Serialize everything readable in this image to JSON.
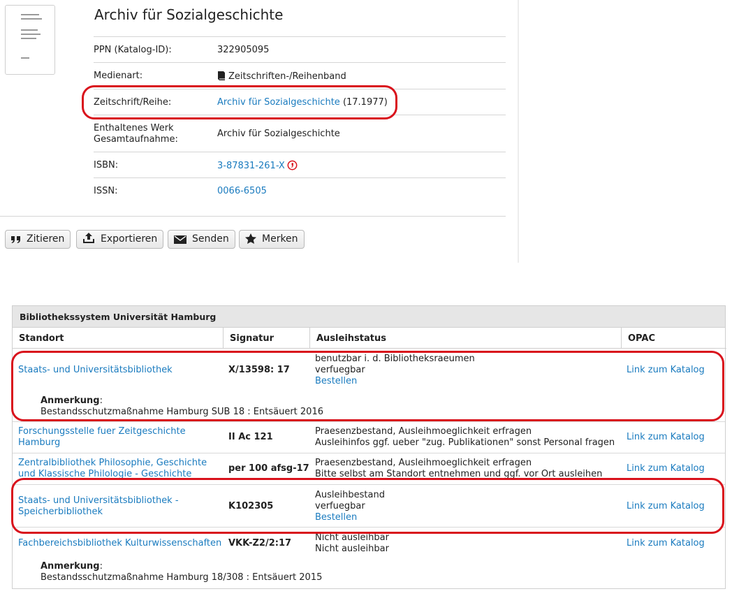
{
  "record": {
    "title": "Archiv für Sozialgeschichte",
    "fields": [
      {
        "label": "PPN (Katalog-ID):",
        "value": "322905095"
      },
      {
        "label": "Medienart:",
        "value": "Zeitschriften-/Reihenband"
      },
      {
        "label": "Zeitschrift/Reihe:",
        "link": "Archiv für Sozialgeschichte",
        "extra": "(17.1977)"
      },
      {
        "label1": "Enthaltenes Werk",
        "label2": "Gesamtaufnahme:",
        "value": "Archiv für Sozialgeschichte"
      },
      {
        "label": "ISBN:",
        "link": "3-87831-261-X"
      },
      {
        "label": "ISSN:",
        "link": "0066-6505"
      }
    ]
  },
  "actions": {
    "cite": "Zitieren",
    "export": "Exportieren",
    "send": "Senden",
    "bookmark": "Merken"
  },
  "holdings": {
    "title": "Bibliothekssystem Universität Hamburg",
    "columns": [
      "Standort",
      "Signatur",
      "Ausleihstatus",
      "OPAC"
    ],
    "note_label": "Anmerkung",
    "note_colon": ":",
    "rows": [
      {
        "location": "Staats- und Universitätsbibliothek",
        "signature": "X/13598: 17",
        "status1": "benutzbar i. d. Bibliotheksraeumen",
        "status2": "verfuegbar",
        "order": "Bestellen",
        "opac": "Link zum Katalog",
        "note": "Bestandsschutzmaßnahme Hamburg SUB 18 : Entsäuert 2016"
      },
      {
        "location1": "Forschungsstelle fuer Zeitgeschichte",
        "location2": "Hamburg",
        "signature": "II Ac 121",
        "status1": "Praesenzbestand, Ausleihmoeglichkeit erfragen",
        "status2": "Ausleihinfos ggf. ueber \"zug. Publikationen\" sonst Personal fragen",
        "opac": "Link zum Katalog"
      },
      {
        "location1": "Zentralbibliothek Philosophie, Geschichte",
        "location2": "und Klassische Philologie - Geschichte",
        "signature": "per 100 afsg-17",
        "status1": "Praesenzbestand, Ausleihmoeglichkeit erfragen",
        "status2": "Bitte selbst am Standort entnehmen und ggf. vor Ort ausleihen",
        "opac": "Link zum Katalog"
      },
      {
        "location1": "Staats- und Universitätsbibliothek -",
        "location2": "Speicherbibliothek",
        "signature": "K102305",
        "status1": "Ausleihbestand",
        "status2": "verfuegbar",
        "order": "Bestellen",
        "opac": "Link zum Katalog"
      },
      {
        "location": "Fachbereichsbibliothek Kulturwissenschaften",
        "signature": "VKK-Z2/2:17",
        "status1": "Nicht ausleihbar",
        "status2": "Nicht ausleihbar",
        "opac": "Link zum Katalog",
        "note": "Bestandsschutzmaßnahme Hamburg 18/308 : Entsäuert 2015"
      }
    ]
  },
  "colors": {
    "link": "#1a7bbf",
    "annotation": "#d9121c",
    "header_bg": "#e6e6e6"
  }
}
